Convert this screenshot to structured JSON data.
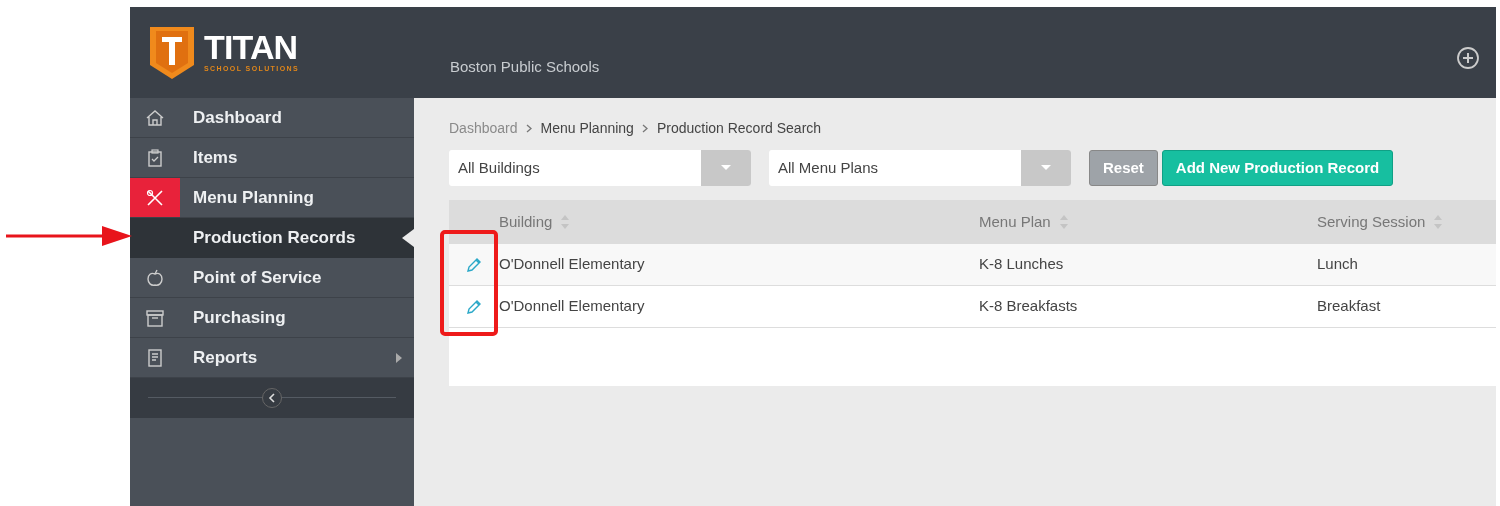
{
  "logo": {
    "name": "TITAN",
    "tagline": "SCHOOL SOLUTIONS"
  },
  "header": {
    "organization": "Boston Public Schools"
  },
  "sidebar": {
    "items": [
      {
        "label": "Dashboard",
        "selected": false,
        "submenu_arrow": false
      },
      {
        "label": "Items",
        "selected": false,
        "submenu_arrow": false
      },
      {
        "label": "Menu Planning",
        "selected": true,
        "submenu_arrow": false,
        "children": [
          {
            "label": "Production Records",
            "selected": true
          }
        ]
      },
      {
        "label": "Point of Service",
        "selected": false,
        "submenu_arrow": false
      },
      {
        "label": "Purchasing",
        "selected": false,
        "submenu_arrow": false
      },
      {
        "label": "Reports",
        "selected": false,
        "submenu_arrow": true
      }
    ]
  },
  "breadcrumb": [
    {
      "label": "Dashboard",
      "link": true
    },
    {
      "label": "Menu Planning",
      "link": false
    },
    {
      "label": "Production Record Search",
      "link": false
    }
  ],
  "filters": [
    {
      "value": "All Buildings"
    },
    {
      "value": "All Menu Plans"
    }
  ],
  "buttons": [
    {
      "label": "Reset",
      "kind": "secondary"
    },
    {
      "label": "Add New Production Record",
      "kind": "primary"
    }
  ],
  "table": {
    "columns": [
      "Building",
      "Menu Plan",
      "Serving Session"
    ],
    "rows": [
      {
        "cells": [
          "O'Donnell Elementary",
          "K-8 Lunches",
          "Lunch"
        ]
      },
      {
        "cells": [
          "O'Donnell Elementary",
          "K-8 Breakfasts",
          "Breakfast"
        ]
      }
    ]
  }
}
